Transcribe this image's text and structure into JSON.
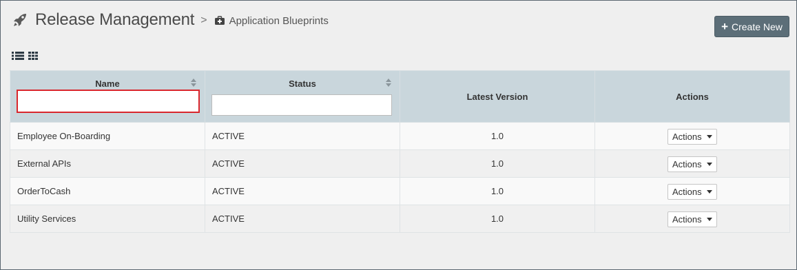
{
  "header": {
    "title": "Release Management",
    "separator": ">",
    "breadcrumb": "Application Blueprints",
    "rocket_icon": "rocket-icon",
    "blueprint_icon": "briefcase-medical-icon"
  },
  "toolbar": {
    "create_label": "Create New",
    "create_icon": "plus-icon",
    "list_view_icon": "list-view-icon",
    "grid_view_icon": "grid-view-icon"
  },
  "table": {
    "columns": {
      "name": "Name",
      "status": "Status",
      "latest_version": "Latest Version",
      "actions": "Actions"
    },
    "filters": {
      "name_value": "",
      "status_value": ""
    },
    "rows": [
      {
        "name": "Employee On-Boarding",
        "status": "ACTIVE",
        "version": "1.0",
        "action_label": "Actions"
      },
      {
        "name": "External APIs",
        "status": "ACTIVE",
        "version": "1.0",
        "action_label": "Actions"
      },
      {
        "name": "OrderToCash",
        "status": "ACTIVE",
        "version": "1.0",
        "action_label": "Actions"
      },
      {
        "name": "Utility Services",
        "status": "ACTIVE",
        "version": "1.0",
        "action_label": "Actions"
      }
    ]
  },
  "colors": {
    "header_bg": "#c9d6dc",
    "button_bg": "#5c6e78",
    "focus_border": "#d9262c"
  }
}
